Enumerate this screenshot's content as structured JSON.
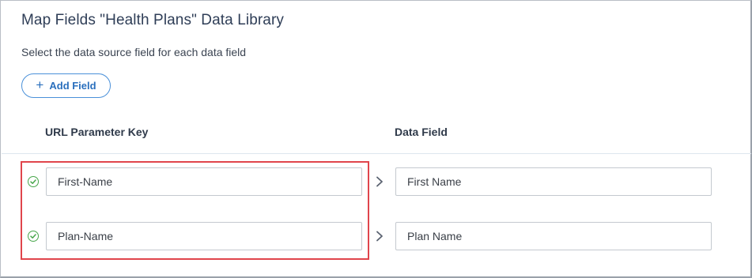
{
  "dialog": {
    "title": "Map Fields \"Health Plans\" Data Library",
    "subtitle": "Select the data source field for each data field",
    "add_button": {
      "icon": "plus-icon",
      "label": "Add Field"
    }
  },
  "table": {
    "headers": {
      "key": "URL Parameter Key",
      "field": "Data Field"
    },
    "rows": [
      {
        "key": "First-Name",
        "field": "First Name",
        "status_icon": "check-circle-icon"
      },
      {
        "key": "Plan-Name",
        "field": "Plan Name",
        "status_icon": "check-circle-icon"
      }
    ]
  },
  "colors": {
    "accent": "#4a90d9",
    "success": "#47a64a",
    "highlight": "#e0454c",
    "title": "#2f3e57"
  }
}
